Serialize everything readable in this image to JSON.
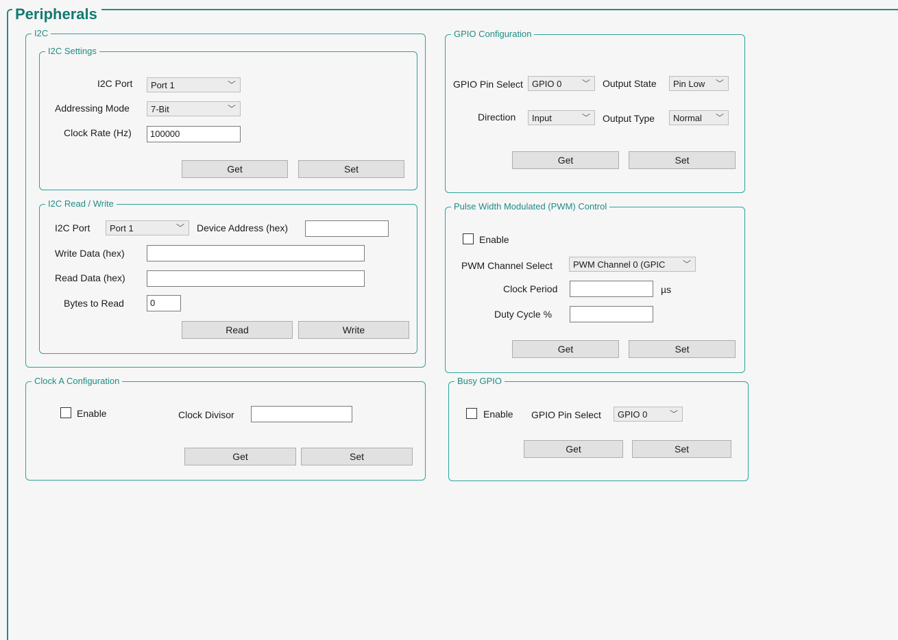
{
  "title": "Peripherals",
  "i2c": {
    "legend": "I2C",
    "settings": {
      "legend": "I2C Settings",
      "port_label": "I2C Port",
      "port_value": "Port 1",
      "addressing_label": "Addressing Mode",
      "addressing_value": "7-Bit",
      "clock_rate_label": "Clock Rate (Hz)",
      "clock_rate_value": "100000",
      "get_label": "Get",
      "set_label": "Set"
    },
    "read_write": {
      "legend": "I2C Read / Write",
      "port_label": "I2C Port",
      "port_value": "Port 1",
      "device_address_label": "Device Address (hex)",
      "device_address_value": "",
      "write_data_label": "Write Data (hex)",
      "write_data_value": "",
      "read_data_label": "Read Data (hex)",
      "read_data_value": "",
      "bytes_to_read_label": "Bytes to Read",
      "bytes_to_read_value": "0",
      "read_label": "Read",
      "write_label": "Write"
    }
  },
  "clock_a": {
    "legend": "Clock A Configuration",
    "enable_label": "Enable",
    "enabled": false,
    "divisor_label": "Clock Divisor",
    "divisor_value": "",
    "get_label": "Get",
    "set_label": "Set"
  },
  "gpio": {
    "legend": "GPIO Configuration",
    "pin_select_label": "GPIO Pin Select",
    "pin_select_value": "GPIO 0",
    "output_state_label": "Output State",
    "output_state_value": "Pin Low",
    "direction_label": "Direction",
    "direction_value": "Input",
    "output_type_label": "Output Type",
    "output_type_value": "Normal",
    "get_label": "Get",
    "set_label": "Set"
  },
  "pwm": {
    "legend": "Pulse Width Modulated (PWM) Control",
    "enable_label": "Enable",
    "enabled": false,
    "channel_label": "PWM Channel Select",
    "channel_value": "PWM Channel 0 (GPIC",
    "clock_period_label": "Clock Period",
    "clock_period_value": "",
    "clock_period_unit": "µs",
    "duty_cycle_label": "Duty Cycle %",
    "duty_cycle_value": "",
    "get_label": "Get",
    "set_label": "Set"
  },
  "busy_gpio": {
    "legend": "Busy GPIO",
    "enable_label": "Enable",
    "enabled": false,
    "pin_select_label": "GPIO Pin Select",
    "pin_select_value": "GPIO 0",
    "get_label": "Get",
    "set_label": "Set"
  },
  "icons": {
    "dropdown": "chevron-down-icon"
  }
}
